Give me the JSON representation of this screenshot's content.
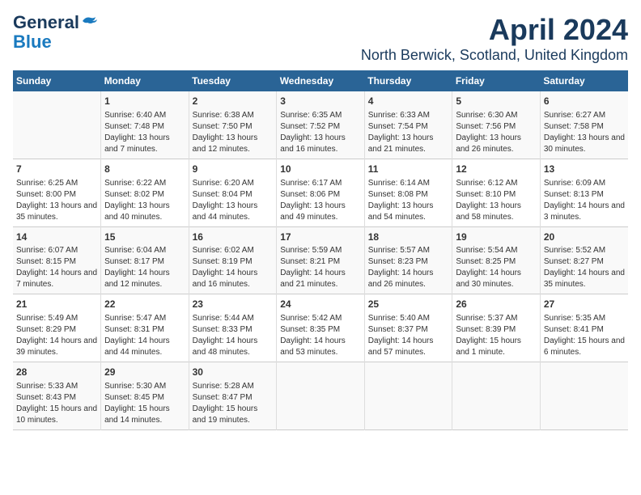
{
  "header": {
    "logo_line1": "General",
    "logo_line2": "Blue",
    "month": "April 2024",
    "location": "North Berwick, Scotland, United Kingdom"
  },
  "weekdays": [
    "Sunday",
    "Monday",
    "Tuesday",
    "Wednesday",
    "Thursday",
    "Friday",
    "Saturday"
  ],
  "weeks": [
    [
      {
        "day": "",
        "sunrise": "",
        "sunset": "",
        "daylight": ""
      },
      {
        "day": "1",
        "sunrise": "Sunrise: 6:40 AM",
        "sunset": "Sunset: 7:48 PM",
        "daylight": "Daylight: 13 hours and 7 minutes."
      },
      {
        "day": "2",
        "sunrise": "Sunrise: 6:38 AM",
        "sunset": "Sunset: 7:50 PM",
        "daylight": "Daylight: 13 hours and 12 minutes."
      },
      {
        "day": "3",
        "sunrise": "Sunrise: 6:35 AM",
        "sunset": "Sunset: 7:52 PM",
        "daylight": "Daylight: 13 hours and 16 minutes."
      },
      {
        "day": "4",
        "sunrise": "Sunrise: 6:33 AM",
        "sunset": "Sunset: 7:54 PM",
        "daylight": "Daylight: 13 hours and 21 minutes."
      },
      {
        "day": "5",
        "sunrise": "Sunrise: 6:30 AM",
        "sunset": "Sunset: 7:56 PM",
        "daylight": "Daylight: 13 hours and 26 minutes."
      },
      {
        "day": "6",
        "sunrise": "Sunrise: 6:27 AM",
        "sunset": "Sunset: 7:58 PM",
        "daylight": "Daylight: 13 hours and 30 minutes."
      }
    ],
    [
      {
        "day": "7",
        "sunrise": "Sunrise: 6:25 AM",
        "sunset": "Sunset: 8:00 PM",
        "daylight": "Daylight: 13 hours and 35 minutes."
      },
      {
        "day": "8",
        "sunrise": "Sunrise: 6:22 AM",
        "sunset": "Sunset: 8:02 PM",
        "daylight": "Daylight: 13 hours and 40 minutes."
      },
      {
        "day": "9",
        "sunrise": "Sunrise: 6:20 AM",
        "sunset": "Sunset: 8:04 PM",
        "daylight": "Daylight: 13 hours and 44 minutes."
      },
      {
        "day": "10",
        "sunrise": "Sunrise: 6:17 AM",
        "sunset": "Sunset: 8:06 PM",
        "daylight": "Daylight: 13 hours and 49 minutes."
      },
      {
        "day": "11",
        "sunrise": "Sunrise: 6:14 AM",
        "sunset": "Sunset: 8:08 PM",
        "daylight": "Daylight: 13 hours and 54 minutes."
      },
      {
        "day": "12",
        "sunrise": "Sunrise: 6:12 AM",
        "sunset": "Sunset: 8:10 PM",
        "daylight": "Daylight: 13 hours and 58 minutes."
      },
      {
        "day": "13",
        "sunrise": "Sunrise: 6:09 AM",
        "sunset": "Sunset: 8:13 PM",
        "daylight": "Daylight: 14 hours and 3 minutes."
      }
    ],
    [
      {
        "day": "14",
        "sunrise": "Sunrise: 6:07 AM",
        "sunset": "Sunset: 8:15 PM",
        "daylight": "Daylight: 14 hours and 7 minutes."
      },
      {
        "day": "15",
        "sunrise": "Sunrise: 6:04 AM",
        "sunset": "Sunset: 8:17 PM",
        "daylight": "Daylight: 14 hours and 12 minutes."
      },
      {
        "day": "16",
        "sunrise": "Sunrise: 6:02 AM",
        "sunset": "Sunset: 8:19 PM",
        "daylight": "Daylight: 14 hours and 16 minutes."
      },
      {
        "day": "17",
        "sunrise": "Sunrise: 5:59 AM",
        "sunset": "Sunset: 8:21 PM",
        "daylight": "Daylight: 14 hours and 21 minutes."
      },
      {
        "day": "18",
        "sunrise": "Sunrise: 5:57 AM",
        "sunset": "Sunset: 8:23 PM",
        "daylight": "Daylight: 14 hours and 26 minutes."
      },
      {
        "day": "19",
        "sunrise": "Sunrise: 5:54 AM",
        "sunset": "Sunset: 8:25 PM",
        "daylight": "Daylight: 14 hours and 30 minutes."
      },
      {
        "day": "20",
        "sunrise": "Sunrise: 5:52 AM",
        "sunset": "Sunset: 8:27 PM",
        "daylight": "Daylight: 14 hours and 35 minutes."
      }
    ],
    [
      {
        "day": "21",
        "sunrise": "Sunrise: 5:49 AM",
        "sunset": "Sunset: 8:29 PM",
        "daylight": "Daylight: 14 hours and 39 minutes."
      },
      {
        "day": "22",
        "sunrise": "Sunrise: 5:47 AM",
        "sunset": "Sunset: 8:31 PM",
        "daylight": "Daylight: 14 hours and 44 minutes."
      },
      {
        "day": "23",
        "sunrise": "Sunrise: 5:44 AM",
        "sunset": "Sunset: 8:33 PM",
        "daylight": "Daylight: 14 hours and 48 minutes."
      },
      {
        "day": "24",
        "sunrise": "Sunrise: 5:42 AM",
        "sunset": "Sunset: 8:35 PM",
        "daylight": "Daylight: 14 hours and 53 minutes."
      },
      {
        "day": "25",
        "sunrise": "Sunrise: 5:40 AM",
        "sunset": "Sunset: 8:37 PM",
        "daylight": "Daylight: 14 hours and 57 minutes."
      },
      {
        "day": "26",
        "sunrise": "Sunrise: 5:37 AM",
        "sunset": "Sunset: 8:39 PM",
        "daylight": "Daylight: 15 hours and 1 minute."
      },
      {
        "day": "27",
        "sunrise": "Sunrise: 5:35 AM",
        "sunset": "Sunset: 8:41 PM",
        "daylight": "Daylight: 15 hours and 6 minutes."
      }
    ],
    [
      {
        "day": "28",
        "sunrise": "Sunrise: 5:33 AM",
        "sunset": "Sunset: 8:43 PM",
        "daylight": "Daylight: 15 hours and 10 minutes."
      },
      {
        "day": "29",
        "sunrise": "Sunrise: 5:30 AM",
        "sunset": "Sunset: 8:45 PM",
        "daylight": "Daylight: 15 hours and 14 minutes."
      },
      {
        "day": "30",
        "sunrise": "Sunrise: 5:28 AM",
        "sunset": "Sunset: 8:47 PM",
        "daylight": "Daylight: 15 hours and 19 minutes."
      },
      {
        "day": "",
        "sunrise": "",
        "sunset": "",
        "daylight": ""
      },
      {
        "day": "",
        "sunrise": "",
        "sunset": "",
        "daylight": ""
      },
      {
        "day": "",
        "sunrise": "",
        "sunset": "",
        "daylight": ""
      },
      {
        "day": "",
        "sunrise": "",
        "sunset": "",
        "daylight": ""
      }
    ]
  ]
}
